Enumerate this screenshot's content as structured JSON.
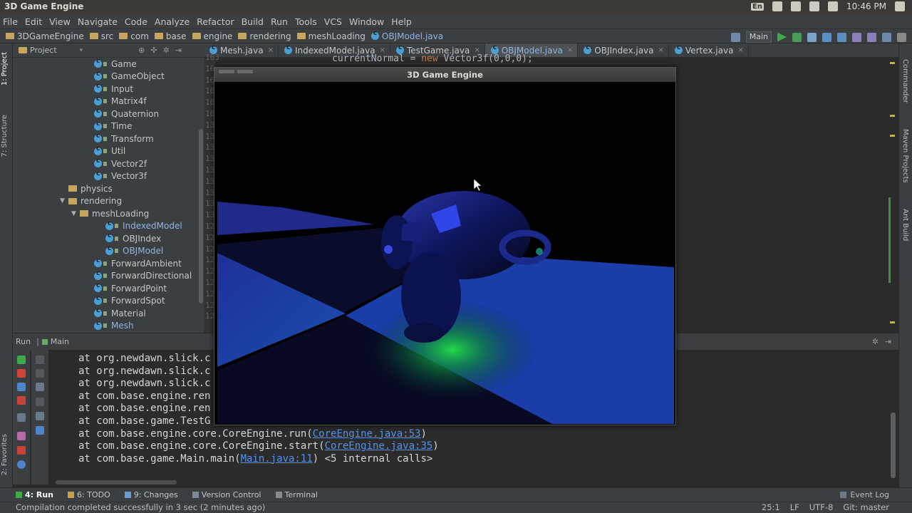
{
  "os": {
    "title": "3D Game Engine",
    "lang": "En",
    "time": "10:46 PM"
  },
  "menu": [
    "File",
    "Edit",
    "View",
    "Navigate",
    "Code",
    "Analyze",
    "Refactor",
    "Build",
    "Run",
    "Tools",
    "VCS",
    "Window",
    "Help"
  ],
  "breadcrumb": [
    "3DGameEngine",
    "src",
    "com",
    "base",
    "engine",
    "rendering",
    "meshLoading",
    "OBJModel.java"
  ],
  "run_config": "Main",
  "left_tabs": [
    "1: Project",
    "7: Structure",
    "2: Favorites"
  ],
  "right_tabs": [
    "Commander",
    "Maven Projects",
    "Ant Build"
  ],
  "project": {
    "header": "Project",
    "tree": [
      {
        "label": "Game",
        "type": "class",
        "indent": 1
      },
      {
        "label": "GameObject",
        "type": "class",
        "indent": 1
      },
      {
        "label": "Input",
        "type": "class",
        "indent": 1
      },
      {
        "label": "Matrix4f",
        "type": "class",
        "indent": 1
      },
      {
        "label": "Quaternion",
        "type": "class",
        "indent": 1
      },
      {
        "label": "Time",
        "type": "class",
        "indent": 1
      },
      {
        "label": "Transform",
        "type": "class",
        "indent": 1
      },
      {
        "label": "Util",
        "type": "class",
        "indent": 1
      },
      {
        "label": "Vector2f",
        "type": "class",
        "indent": 1
      },
      {
        "label": "Vector3f",
        "type": "class",
        "indent": 1
      },
      {
        "label": "physics",
        "type": "package",
        "indent": 0
      },
      {
        "label": "rendering",
        "type": "package-open",
        "indent": 0
      },
      {
        "label": "meshLoading",
        "type": "package-open",
        "indent": 1
      },
      {
        "label": "IndexedModel",
        "type": "class-blue",
        "indent": 2
      },
      {
        "label": "OBJIndex",
        "type": "class",
        "indent": 2
      },
      {
        "label": "OBJModel",
        "type": "class-blue",
        "indent": 2
      },
      {
        "label": "ForwardAmbient",
        "type": "class",
        "indent": 1
      },
      {
        "label": "ForwardDirectional",
        "type": "class",
        "indent": 1
      },
      {
        "label": "ForwardPoint",
        "type": "class",
        "indent": 1
      },
      {
        "label": "ForwardSpot",
        "type": "class",
        "indent": 1
      },
      {
        "label": "Material",
        "type": "class",
        "indent": 1
      },
      {
        "label": "Mesh",
        "type": "class-blue",
        "indent": 1
      }
    ]
  },
  "editor": {
    "tabs": [
      {
        "label": "Mesh.java",
        "active": false
      },
      {
        "label": "IndexedModel.java",
        "active": false
      },
      {
        "label": "TestGame.java",
        "active": false
      },
      {
        "label": "OBJModel.java",
        "active": true
      },
      {
        "label": "OBJIndex.java",
        "active": false
      },
      {
        "label": "Vertex.java",
        "active": false
      }
    ],
    "gutter": [
      "163",
      "16",
      "16",
      "16",
      "16",
      "16",
      "13",
      "13",
      "13",
      "13",
      "13",
      "13",
      "13",
      "13",
      "13",
      "12",
      "12",
      "12",
      "12",
      "12",
      "12",
      "12",
      "12",
      "12"
    ],
    "code_prefix": "currentNormal = ",
    "code_keyword": "new",
    "code_rest": " Vector3f(0,0,0);"
  },
  "run": {
    "label": "Run",
    "config": "Main",
    "lines": [
      {
        "text": "at org.newdawn.slick.c",
        "link": "",
        "suffix": ""
      },
      {
        "text": "at org.newdawn.slick.c",
        "link": "",
        "suffix": ""
      },
      {
        "text": "at org.newdawn.slick.c",
        "link": "",
        "suffix": ""
      },
      {
        "text": "at com.base.engine.ren",
        "link": "",
        "suffix": ""
      },
      {
        "text": "at com.base.engine.ren",
        "link": "",
        "suffix": ""
      },
      {
        "text": "at com.base.game.TestG",
        "link": "",
        "suffix": ""
      },
      {
        "text": "at com.base.engine.core.CoreEngine.run(",
        "link": "CoreEngine.java:53",
        "suffix": ")"
      },
      {
        "text": "at com.base.engine.core.CoreEngine.start(",
        "link": "CoreEngine.java:35",
        "suffix": ")"
      },
      {
        "text": "at com.base.game.Main.main(",
        "link": "Main.java:11",
        "suffix": ") <5 internal calls>"
      }
    ]
  },
  "tool_tabs": [
    {
      "label": "4: Run",
      "active": true
    },
    {
      "label": "6: TODO",
      "active": false
    },
    {
      "label": "9: Changes",
      "active": false
    },
    {
      "label": "Version Control",
      "active": false
    },
    {
      "label": "Terminal",
      "active": false
    }
  ],
  "event_log": "Event Log",
  "status": {
    "message": "Compilation completed successfully in 3 sec (2 minutes ago)",
    "position": "25:1",
    "line_sep": "LF",
    "encoding": "UTF-8",
    "git": "Git: master"
  },
  "game_window": {
    "title": "3D Game Engine"
  },
  "colors": {
    "ide_bg": "#2b2b2b",
    "panel_bg": "#3c3f41",
    "link": "#5394ec",
    "active_tab": "#8fb5e5"
  }
}
